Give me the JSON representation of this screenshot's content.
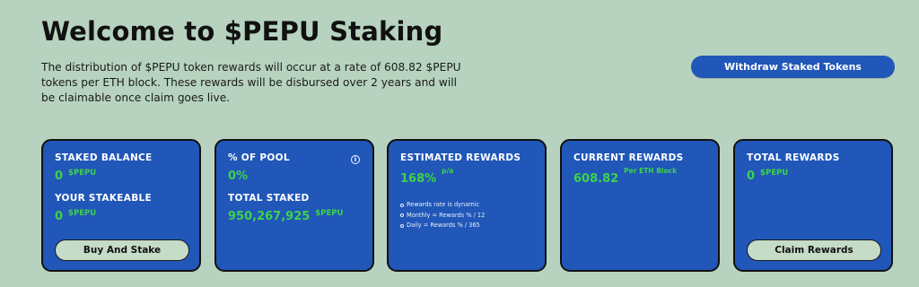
{
  "header": {
    "title": "Welcome to $PEPU Staking",
    "description": "The distribution of $PEPU token rewards will occur at a rate of 608.82 $PEPU tokens per ETH block. These rewards will be disbursed over 2 years and will be claimable once claim goes live.",
    "withdraw_label": "Withdraw Staked Tokens"
  },
  "cards": {
    "staked": {
      "label": "STAKED BALANCE",
      "value": "0",
      "unit": "$PEPU",
      "stakeable_label": "YOUR STAKEABLE",
      "stakeable_value": "0",
      "stakeable_unit": "$PEPU",
      "button_label": "Buy And Stake"
    },
    "pool": {
      "label": "% OF POOL",
      "value": "0%",
      "info_icon": "i",
      "total_label": "TOTAL STAKED",
      "total_value": "950,267,925",
      "total_unit": "$PEPU"
    },
    "estimated": {
      "label": "ESTIMATED REWARDS",
      "value": "168%",
      "suffix": "p/a",
      "notes": [
        "Rewards rate is dynamic",
        "Monthly = Rewards % / 12",
        "Daily = Rewards % / 365"
      ]
    },
    "current": {
      "label": "CURRENT REWARDS",
      "value": "608.82",
      "suffix": "Per ETH Block"
    },
    "total": {
      "label": "TOTAL REWARDS",
      "value": "0",
      "unit": "$PEPU",
      "button_label": "Claim Rewards"
    }
  },
  "colors": {
    "background": "#b7d3bf",
    "card": "#2057b8",
    "accent_green": "#3fd24a",
    "button_light": "#c5dcc8"
  }
}
